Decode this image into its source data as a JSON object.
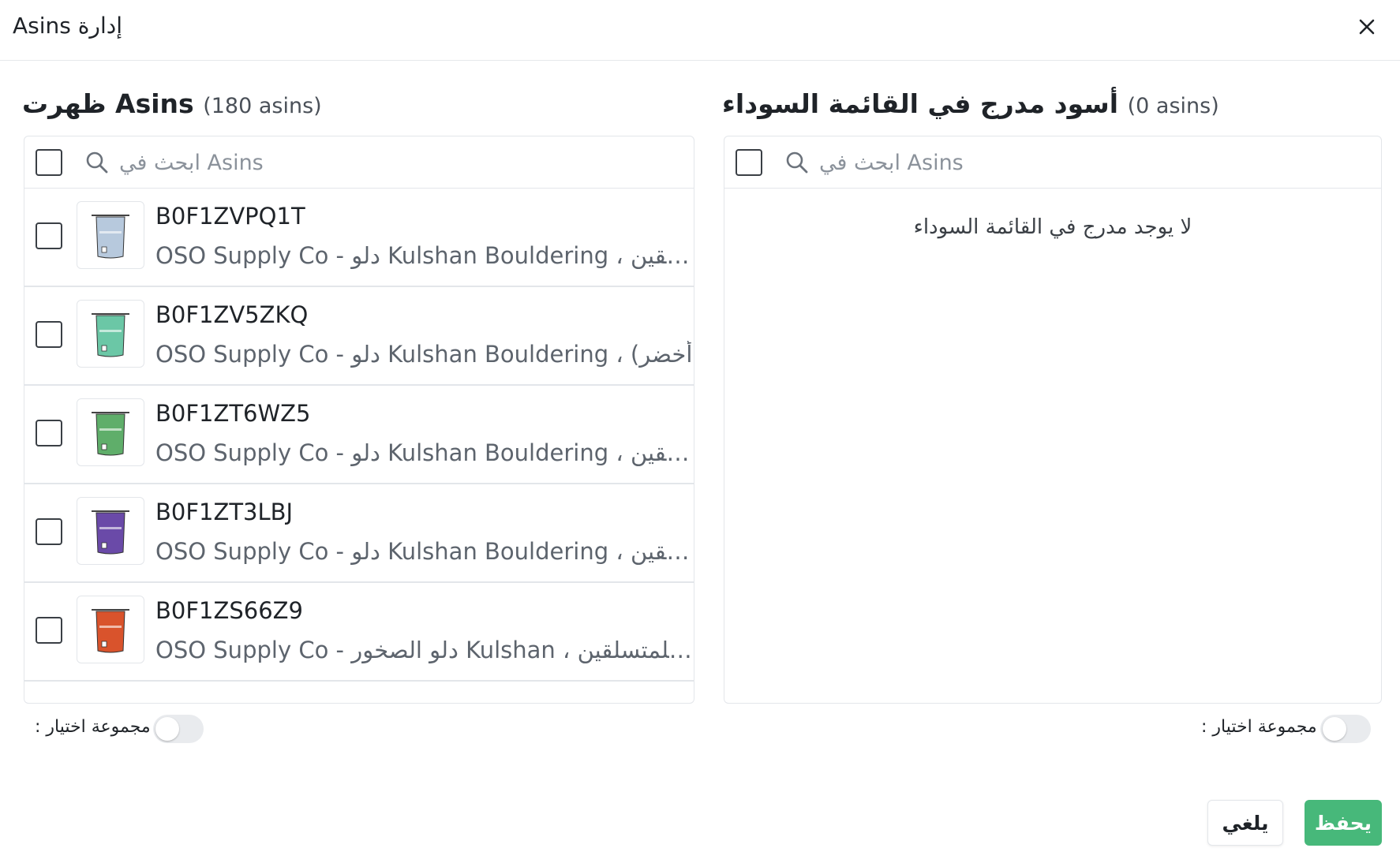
{
  "header": {
    "title": "إدارة Asins",
    "close_icon": "close-icon"
  },
  "left_panel": {
    "title": "ظهرت Asins",
    "count": "(180 asins)",
    "search": {
      "placeholder": "ابحث في Asins",
      "value": ""
    },
    "items": [
      {
        "asin": "B0F1ZVPQ1T",
        "description": "OSO Supply Co - دلو Kulshan Bouldering ، حقيبة طباشير للمتسلقين",
        "color": "#b7c9dd"
      },
      {
        "asin": "B0F1ZV5ZKQ",
        "description": "OSO Supply Co - دلو Kulshan Bouldering ، (أخضر",
        "color": "#6bc7a6"
      },
      {
        "asin": "B0F1ZT6WZ5",
        "description": "OSO Supply Co - دلو Kulshan Bouldering ، حقيبة طباشير للمتسلقين",
        "color": "#5fae6a"
      },
      {
        "asin": "B0F1ZT3LBJ",
        "description": "OSO Supply Co - دلو Kulshan Bouldering ، حقيبة طباشير للمتسلقين",
        "color": "#6a4aa8"
      },
      {
        "asin": "B0F1ZS66Z9",
        "description": "OSO Supply Co - دلو الصخور Kulshan ، حقيبة طباشير للمتسلقين",
        "color": "#d9532c"
      }
    ],
    "select_group_label": ": مجموعة اختيار",
    "select_group_on": false
  },
  "right_panel": {
    "title": "أسود مدرج في القائمة السوداء",
    "count": "(0 asins)",
    "search": {
      "placeholder": "ابحث في Asins",
      "value": ""
    },
    "empty_message": "لا يوجد مدرج في القائمة السوداء",
    "select_group_label": ": مجموعة اختيار",
    "select_group_on": false
  },
  "footer": {
    "cancel_label": "يلغي",
    "save_label": "يحفظ"
  },
  "colors": {
    "accent": "#47b87a",
    "border": "#e3e6ea"
  }
}
